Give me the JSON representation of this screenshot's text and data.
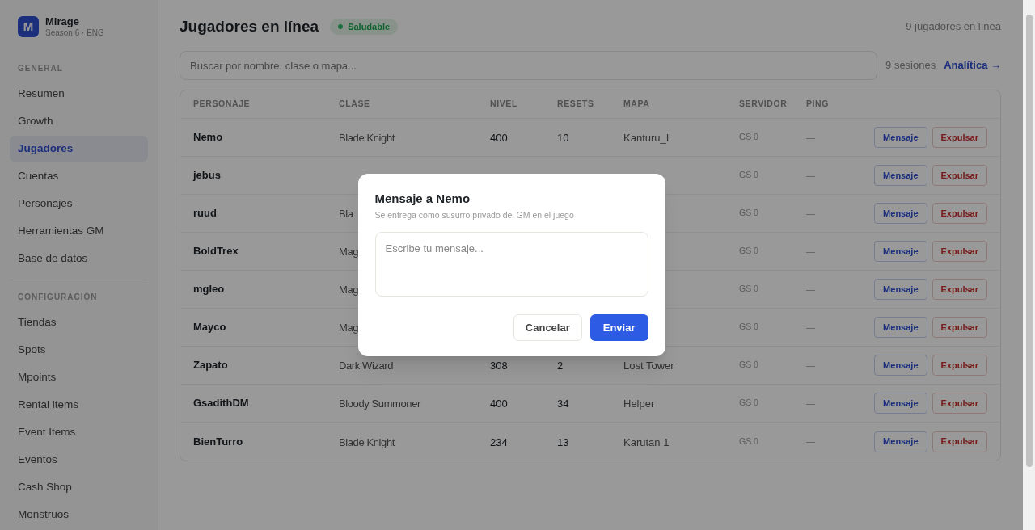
{
  "brand": {
    "logo": "M",
    "name": "Mirage",
    "subtitle": "Season 6 · ENG"
  },
  "sidebar": {
    "sections": [
      {
        "title": "GENERAL",
        "items": [
          {
            "label": "Resumen",
            "selected": false
          },
          {
            "label": "Growth",
            "selected": false
          },
          {
            "label": "Jugadores",
            "selected": true
          },
          {
            "label": "Cuentas",
            "selected": false
          },
          {
            "label": "Personajes",
            "selected": false
          },
          {
            "label": "Herramientas GM",
            "selected": false
          },
          {
            "label": "Base de datos",
            "selected": false
          }
        ]
      },
      {
        "title": "CONFIGURACIÓN",
        "items": [
          {
            "label": "Tiendas",
            "selected": false
          },
          {
            "label": "Spots",
            "selected": false
          },
          {
            "label": "Mpoints",
            "selected": false
          },
          {
            "label": "Rental items",
            "selected": false
          },
          {
            "label": "Event Items",
            "selected": false
          },
          {
            "label": "Eventos",
            "selected": false
          },
          {
            "label": "Cash Shop",
            "selected": false
          },
          {
            "label": "Monstruos",
            "selected": false
          }
        ]
      }
    ]
  },
  "header": {
    "title": "Jugadores en línea",
    "status": {
      "label": "Saludable",
      "color": "#1a7040"
    },
    "count": "9 jugadores en línea"
  },
  "search": {
    "placeholder": "Buscar por nombre, clase o mapa..."
  },
  "sessions": "9 sesiones",
  "analytics_link": "Analítica →",
  "table": {
    "columns": [
      "PERSONAJE",
      "CLASE",
      "NIVEL",
      "RESETS",
      "MAPA",
      "SERVIDOR",
      "PING"
    ],
    "rows": [
      {
        "name": "Nemo",
        "class": "Blade Knight",
        "level": "400",
        "resets": "10",
        "map": "Kanturu_I",
        "server": "GS 0",
        "ping": "—",
        "message": "Mensaje",
        "kick": "Expulsar"
      },
      {
        "name": "jebus",
        "server": "GS 0",
        "ping": "—",
        "message": "Mensaje",
        "kick": "Expulsar"
      },
      {
        "name": "ruud",
        "class": "Bla",
        "server": "GS 0",
        "ping": "—",
        "message": "Mensaje",
        "kick": "Expulsar"
      },
      {
        "name": "BoldTrex",
        "class": "Mag",
        "server": "GS 0",
        "ping": "—",
        "message": "Mensaje",
        "kick": "Expulsar"
      },
      {
        "name": "mgleo",
        "class": "Mag",
        "server": "GS 0",
        "ping": "—",
        "message": "Mensaje",
        "kick": "Expulsar"
      },
      {
        "name": "Mayco",
        "class": "Mag",
        "server": "GS 0",
        "ping": "—",
        "message": "Mensaje",
        "kick": "Expulsar"
      },
      {
        "name": "Zapato",
        "class": "Dark Wizard",
        "level": "308",
        "resets": "2",
        "map": "Lost Tower",
        "server": "GS 0",
        "ping": "—",
        "message": "Mensaje",
        "kick": "Expulsar"
      },
      {
        "name": "GsadithDM",
        "class": "Bloody Summoner",
        "level": "400",
        "resets": "34",
        "map": "Helper",
        "server": "GS 0",
        "ping": "—",
        "message": "Mensaje",
        "kick": "Expulsar"
      },
      {
        "name": "BienTurro",
        "class": "Blade Knight",
        "level": "234",
        "resets": "13",
        "map": "Karutan 1",
        "server": "GS 0",
        "ping": "—",
        "message": "Mensaje",
        "kick": "Expulsar"
      }
    ]
  },
  "dialog": {
    "title": "Mensaje a Nemo",
    "subtitle": "Se entrega como susurro privado del GM en el juego",
    "placeholder": "Escribe tu mensaje...",
    "cancel": "Cancelar",
    "send": "Enviar"
  }
}
